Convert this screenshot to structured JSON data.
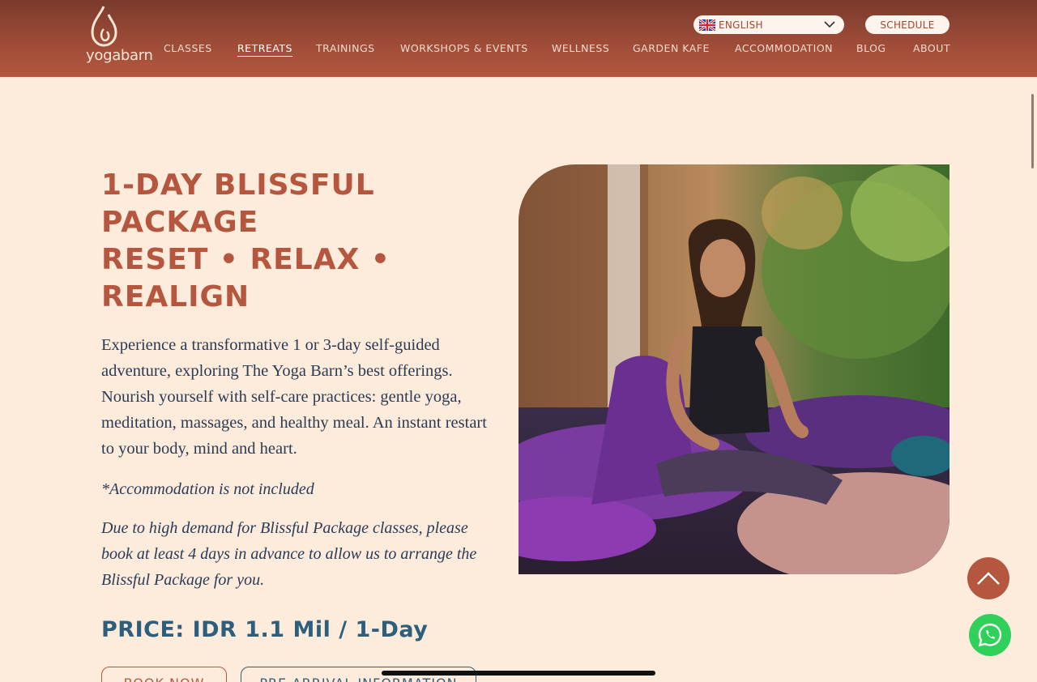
{
  "header": {
    "logo_text": "yogabarn",
    "nav": [
      {
        "label": "CLASSES"
      },
      {
        "label": "RETREATS"
      },
      {
        "label": "TRAININGS"
      },
      {
        "label": "WORKSHOPS & EVENTS"
      },
      {
        "label": "WELLNESS"
      },
      {
        "label": "GARDEN KAFE"
      },
      {
        "label": "ACCOMMODATION"
      },
      {
        "label": "BLOG"
      },
      {
        "label": "ABOUT"
      }
    ],
    "active_nav": "RETREATS",
    "language": "ENGLISH",
    "schedule_label": "SCHEDULE"
  },
  "main": {
    "title_lines": [
      "1-DAY BLISSFUL",
      "PACKAGE",
      "RESET • RELAX •",
      "REALIGN"
    ],
    "description": "Experience a transformative 1 or 3-day self-guided adventure, exploring The Yoga Barn’s best offerings. Nourish yourself with self-care practices: gentle yoga, meditation, massages, and healthy meal. An instant restart to your body, mind and heart.",
    "note": "*Accommodation is not included",
    "demand_note": "Due to high demand for Blissful Package classes, please book at least 4 days in advance to allow us to arrange the Blissful Package for you.",
    "price": "PRICE: IDR 1.1 Mil / 1-Day",
    "book_label": "BOOK NOW",
    "pre_arrival_label": "PRE-ARRIVAL INFORMATION"
  },
  "icons": {
    "scroll_top": "chevron-up-icon",
    "whatsapp": "whatsapp-icon",
    "flag": "uk-flag-icon"
  },
  "colors": {
    "header_bg": "#9a4a36",
    "page_bg": "#fdebdc",
    "accent": "#b5573f",
    "price": "#2d5e7c",
    "whatsapp": "#2fd15a"
  }
}
